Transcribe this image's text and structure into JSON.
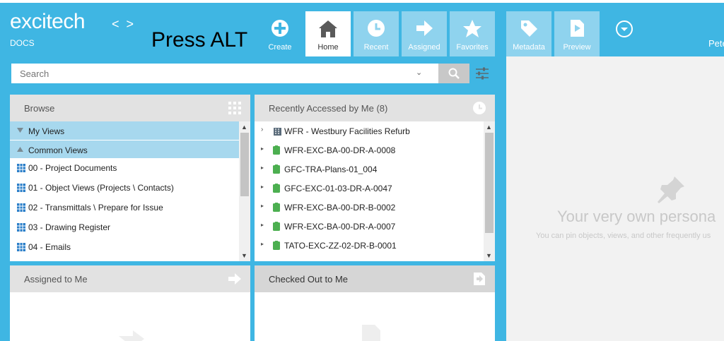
{
  "app": {
    "logo": "excitech",
    "product": "DOCS",
    "back_arrow": "<",
    "forward_arrow": ">",
    "hint": "Press ALT",
    "user_partial": "Pete"
  },
  "tabs": [
    {
      "label": "Create",
      "icon": "plus-circle-icon"
    },
    {
      "label": "Home",
      "icon": "home-icon"
    },
    {
      "label": "Recent",
      "icon": "clock-icon"
    },
    {
      "label": "Assigned",
      "icon": "arrow-right-icon"
    },
    {
      "label": "Favorites",
      "icon": "star-icon"
    },
    {
      "label": "Metadata",
      "icon": "tag-icon"
    },
    {
      "label": "Preview",
      "icon": "preview-icon"
    }
  ],
  "search": {
    "placeholder": "Search",
    "dropdown_glyph": "⌄"
  },
  "browse": {
    "title": "Browse",
    "sections": [
      "My Views",
      "Common Views"
    ],
    "items": [
      "00 - Project Documents",
      "01 - Object Views (Projects \\ Contacts)",
      "02 - Transmittals \\ Prepare for Issue",
      "03 - Drawing Register",
      "04 - Emails"
    ]
  },
  "recent": {
    "title": "Recently Accessed by Me (8)",
    "items": [
      "WFR - Westbury Facilities Refurb",
      "WFR-EXC-BA-00-DR-A-0008",
      "GFC-TRA-Plans-01_004",
      "GFC-EXC-01-03-DR-A-0047",
      "WFR-EXC-BA-00-DR-B-0002",
      "WFR-EXC-BA-00-DR-A-0007",
      "TATO-EXC-ZZ-02-DR-B-0001"
    ]
  },
  "assigned": {
    "title": "Assigned to Me"
  },
  "checkedout": {
    "title": "Checked Out to Me"
  },
  "pinned": {
    "title": "Your very own persona",
    "subtitle": "You can pin objects, views, and other frequently us"
  },
  "colors": {
    "accent": "#3fb6e3",
    "light_tab": "#8fd3ee",
    "selected_row": "#a7d8ee",
    "doc_icon": "#4caf50"
  }
}
